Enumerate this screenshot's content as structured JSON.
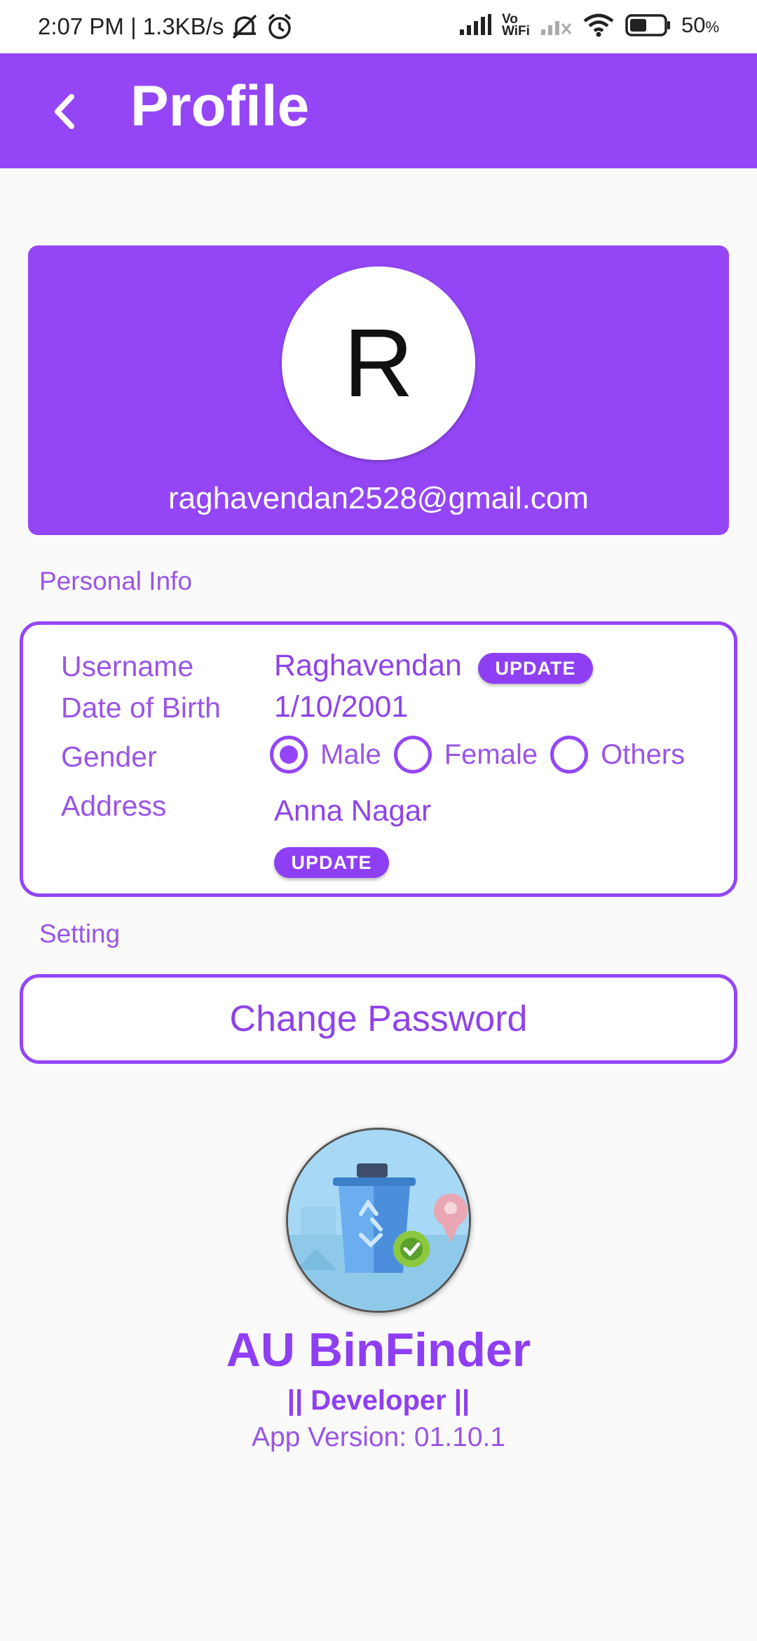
{
  "status_bar": {
    "time_speed": "2:07 PM | 1.3KB/s",
    "vowifi": "Vo\nWiFi",
    "battery": "50",
    "battery_unit": "%",
    "battery_level": 0.5,
    "icons": [
      "mute-icon",
      "alarm-icon",
      "signal-icon",
      "vowifi-icon",
      "no-signal-icon",
      "wifi-icon",
      "battery-icon"
    ]
  },
  "app_bar": {
    "title": "Profile",
    "back_icon": "back-arrow-icon",
    "color": "#9446f6"
  },
  "profile": {
    "avatar_letter": "R",
    "email": "raghavendan2528@gmail.com"
  },
  "personal_info": {
    "section_label": "Personal Info",
    "username_label": "Username",
    "username_value": "Raghavendan",
    "username_update": "UPDATE",
    "dob_label": "Date of Birth",
    "dob_value": "1/10/2001",
    "gender_label": "Gender",
    "gender_options": [
      "Male",
      "Female",
      "Others"
    ],
    "gender_selected": "Male",
    "address_label": "Address",
    "address_value": "Anna Nagar",
    "address_update": "UPDATE"
  },
  "settings": {
    "section_label": "Setting",
    "change_password": "Change Password"
  },
  "footer": {
    "logo_icon": "recycle-bin-logo-icon",
    "app_name": "AU BinFinder",
    "role": "|| Developer ||",
    "version": "App Version: 01.10.1"
  }
}
